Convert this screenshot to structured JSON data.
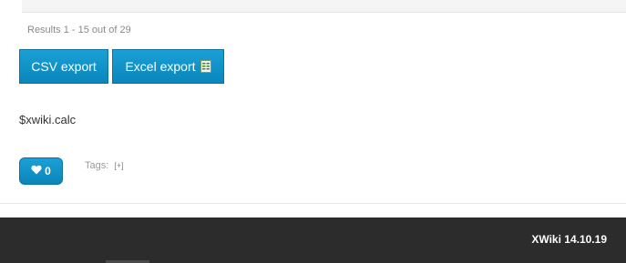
{
  "results": {
    "summary": "Results 1 - 15 out of 29"
  },
  "export": {
    "csv_label": "CSV export",
    "excel_label": "Excel export"
  },
  "content": {
    "text": "$xwiki.calc"
  },
  "like": {
    "count": "0"
  },
  "tags": {
    "label": "Tags:",
    "add_label": "[+]"
  },
  "footer": {
    "version": "XWiki 14.10.19"
  },
  "colors": {
    "button_blue": "#0a86ba",
    "footer_bg": "#2c2c2c"
  },
  "icons": {
    "excel": "excel-file-icon",
    "like": "heart-icon"
  }
}
